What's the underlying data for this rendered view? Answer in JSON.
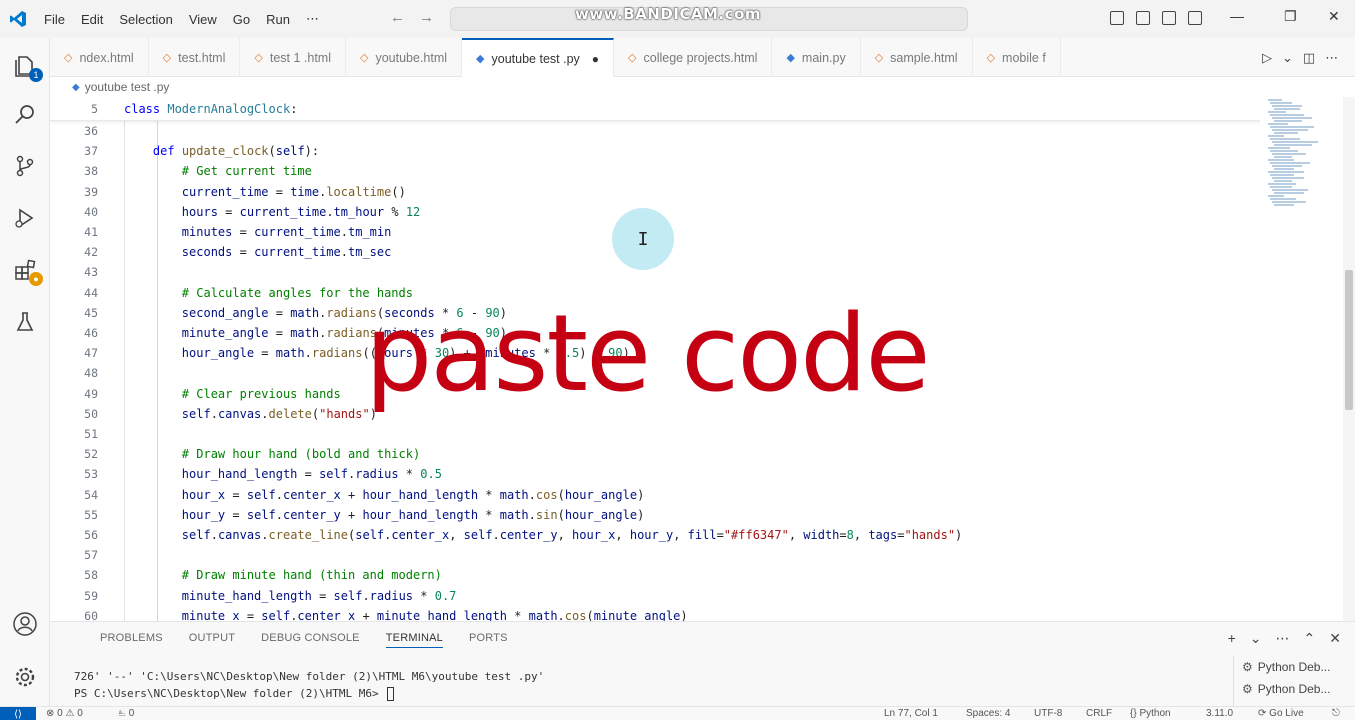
{
  "menu": [
    "File",
    "Edit",
    "Selection",
    "View",
    "Go",
    "Run",
    "⋯"
  ],
  "watermark": "www.BANDICAM.com",
  "tabs": [
    {
      "label": "ndex.html",
      "icon": "html-icon",
      "active": false
    },
    {
      "label": "test.html",
      "icon": "html-icon",
      "active": false
    },
    {
      "label": "test 1 .html",
      "icon": "html-icon",
      "active": false
    },
    {
      "label": "youtube.html",
      "icon": "html-icon",
      "active": false
    },
    {
      "label": "youtube test .py",
      "icon": "python-icon",
      "active": true,
      "modified": true
    },
    {
      "label": "college projects.html",
      "icon": "html-icon",
      "active": false
    },
    {
      "label": "main.py",
      "icon": "python-icon",
      "active": false
    },
    {
      "label": "sample.html",
      "icon": "html-icon",
      "active": false
    },
    {
      "label": "mobile f",
      "icon": "html-icon",
      "active": false
    }
  ],
  "breadcrumb": "youtube test .py",
  "sticky": {
    "ln": "5",
    "kw": "class",
    "name": "ModernAnalogClock",
    "tail": ":"
  },
  "code": [
    {
      "ln": "36",
      "t": []
    },
    {
      "ln": "37",
      "t": [
        [
          "    ",
          ""
        ],
        [
          "def",
          "kw"
        ],
        [
          " ",
          ""
        ],
        [
          "update_clock",
          "fn"
        ],
        [
          "(",
          ""
        ],
        [
          "self",
          "var"
        ],
        [
          "):",
          ""
        ]
      ]
    },
    {
      "ln": "38",
      "t": [
        [
          "        ",
          ""
        ],
        [
          "# Get current time",
          "cm"
        ]
      ]
    },
    {
      "ln": "39",
      "t": [
        [
          "        ",
          ""
        ],
        [
          "current_time",
          "var"
        ],
        [
          " = ",
          ""
        ],
        [
          "time",
          "var"
        ],
        [
          ".",
          ""
        ],
        [
          "localtime",
          "fn"
        ],
        [
          "()",
          ""
        ]
      ]
    },
    {
      "ln": "40",
      "t": [
        [
          "        ",
          ""
        ],
        [
          "hours",
          "var"
        ],
        [
          " = ",
          ""
        ],
        [
          "current_time",
          "var"
        ],
        [
          ".",
          ""
        ],
        [
          "tm_hour",
          "var"
        ],
        [
          " % ",
          ""
        ],
        [
          "12",
          "num"
        ]
      ]
    },
    {
      "ln": "41",
      "t": [
        [
          "        ",
          ""
        ],
        [
          "minutes",
          "var"
        ],
        [
          " = ",
          ""
        ],
        [
          "current_time",
          "var"
        ],
        [
          ".",
          ""
        ],
        [
          "tm_min",
          "var"
        ]
      ]
    },
    {
      "ln": "42",
      "t": [
        [
          "        ",
          ""
        ],
        [
          "seconds",
          "var"
        ],
        [
          " = ",
          ""
        ],
        [
          "current_time",
          "var"
        ],
        [
          ".",
          ""
        ],
        [
          "tm_sec",
          "var"
        ]
      ]
    },
    {
      "ln": "43",
      "t": []
    },
    {
      "ln": "44",
      "t": [
        [
          "        ",
          ""
        ],
        [
          "# Calculate angles for the hands",
          "cm"
        ]
      ]
    },
    {
      "ln": "45",
      "t": [
        [
          "        ",
          ""
        ],
        [
          "second_angle",
          "var"
        ],
        [
          " = ",
          ""
        ],
        [
          "math",
          "var"
        ],
        [
          ".",
          ""
        ],
        [
          "radians",
          "fn"
        ],
        [
          "(",
          ""
        ],
        [
          "seconds",
          "var"
        ],
        [
          " * ",
          ""
        ],
        [
          "6",
          "num"
        ],
        [
          " - ",
          ""
        ],
        [
          "90",
          "num"
        ],
        [
          ")",
          ""
        ]
      ]
    },
    {
      "ln": "46",
      "t": [
        [
          "        ",
          ""
        ],
        [
          "minute_angle",
          "var"
        ],
        [
          " = ",
          ""
        ],
        [
          "math",
          "var"
        ],
        [
          ".",
          ""
        ],
        [
          "radians",
          "fn"
        ],
        [
          "(",
          ""
        ],
        [
          "minutes",
          "var"
        ],
        [
          " * ",
          ""
        ],
        [
          "6",
          "num"
        ],
        [
          " - ",
          ""
        ],
        [
          "90",
          "num"
        ],
        [
          ")",
          ""
        ]
      ]
    },
    {
      "ln": "47",
      "t": [
        [
          "        ",
          ""
        ],
        [
          "hour_angle",
          "var"
        ],
        [
          " = ",
          ""
        ],
        [
          "math",
          "var"
        ],
        [
          ".",
          ""
        ],
        [
          "radians",
          "fn"
        ],
        [
          "((",
          ""
        ],
        [
          "hours",
          "var"
        ],
        [
          " * ",
          ""
        ],
        [
          "30",
          "num"
        ],
        [
          ") + (",
          ""
        ],
        [
          "minutes",
          "var"
        ],
        [
          " * ",
          ""
        ],
        [
          "0.5",
          "num"
        ],
        [
          ") - ",
          ""
        ],
        [
          "90",
          "num"
        ],
        [
          ")",
          ""
        ]
      ]
    },
    {
      "ln": "48",
      "t": []
    },
    {
      "ln": "49",
      "t": [
        [
          "        ",
          ""
        ],
        [
          "# Clear previous hands",
          "cm"
        ]
      ]
    },
    {
      "ln": "50",
      "t": [
        [
          "        ",
          ""
        ],
        [
          "self",
          "var"
        ],
        [
          ".",
          ""
        ],
        [
          "canvas",
          "var"
        ],
        [
          ".",
          ""
        ],
        [
          "delete",
          "fn"
        ],
        [
          "(",
          ""
        ],
        [
          "\"hands\"",
          "str"
        ],
        [
          ")",
          ""
        ]
      ]
    },
    {
      "ln": "51",
      "t": []
    },
    {
      "ln": "52",
      "t": [
        [
          "        ",
          ""
        ],
        [
          "# Draw hour hand (bold and thick)",
          "cm"
        ]
      ]
    },
    {
      "ln": "53",
      "t": [
        [
          "        ",
          ""
        ],
        [
          "hour_hand_length",
          "var"
        ],
        [
          " = ",
          ""
        ],
        [
          "self",
          "var"
        ],
        [
          ".",
          ""
        ],
        [
          "radius",
          "var"
        ],
        [
          " * ",
          ""
        ],
        [
          "0.5",
          "num"
        ]
      ]
    },
    {
      "ln": "54",
      "t": [
        [
          "        ",
          ""
        ],
        [
          "hour_x",
          "var"
        ],
        [
          " = ",
          ""
        ],
        [
          "self",
          "var"
        ],
        [
          ".",
          ""
        ],
        [
          "center_x",
          "var"
        ],
        [
          " + ",
          ""
        ],
        [
          "hour_hand_length",
          "var"
        ],
        [
          " * ",
          ""
        ],
        [
          "math",
          "var"
        ],
        [
          ".",
          ""
        ],
        [
          "cos",
          "fn"
        ],
        [
          "(",
          ""
        ],
        [
          "hour_angle",
          "var"
        ],
        [
          ")",
          ""
        ]
      ]
    },
    {
      "ln": "55",
      "t": [
        [
          "        ",
          ""
        ],
        [
          "hour_y",
          "var"
        ],
        [
          " = ",
          ""
        ],
        [
          "self",
          "var"
        ],
        [
          ".",
          ""
        ],
        [
          "center_y",
          "var"
        ],
        [
          " + ",
          ""
        ],
        [
          "hour_hand_length",
          "var"
        ],
        [
          " * ",
          ""
        ],
        [
          "math",
          "var"
        ],
        [
          ".",
          ""
        ],
        [
          "sin",
          "fn"
        ],
        [
          "(",
          ""
        ],
        [
          "hour_angle",
          "var"
        ],
        [
          ")",
          ""
        ]
      ]
    },
    {
      "ln": "56",
      "t": [
        [
          "        ",
          ""
        ],
        [
          "self",
          "var"
        ],
        [
          ".",
          ""
        ],
        [
          "canvas",
          "var"
        ],
        [
          ".",
          ""
        ],
        [
          "create_line",
          "fn"
        ],
        [
          "(",
          ""
        ],
        [
          "self",
          "var"
        ],
        [
          ".",
          ""
        ],
        [
          "center_x",
          "var"
        ],
        [
          ", ",
          ""
        ],
        [
          "self",
          "var"
        ],
        [
          ".",
          ""
        ],
        [
          "center_y",
          "var"
        ],
        [
          ", ",
          ""
        ],
        [
          "hour_x",
          "var"
        ],
        [
          ", ",
          ""
        ],
        [
          "hour_y",
          "var"
        ],
        [
          ", ",
          ""
        ],
        [
          "fill",
          "var"
        ],
        [
          "=",
          ""
        ],
        [
          "\"#ff6347\"",
          "str"
        ],
        [
          ", ",
          ""
        ],
        [
          "width",
          "var"
        ],
        [
          "=",
          ""
        ],
        [
          "8",
          "num"
        ],
        [
          ", ",
          ""
        ],
        [
          "tags",
          "var"
        ],
        [
          "=",
          ""
        ],
        [
          "\"hands\"",
          "str"
        ],
        [
          ")",
          ""
        ]
      ]
    },
    {
      "ln": "57",
      "t": []
    },
    {
      "ln": "58",
      "t": [
        [
          "        ",
          ""
        ],
        [
          "# Draw minute hand (thin and modern)",
          "cm"
        ]
      ]
    },
    {
      "ln": "59",
      "t": [
        [
          "        ",
          ""
        ],
        [
          "minute_hand_length",
          "var"
        ],
        [
          " = ",
          ""
        ],
        [
          "self",
          "var"
        ],
        [
          ".",
          ""
        ],
        [
          "radius",
          "var"
        ],
        [
          " * ",
          ""
        ],
        [
          "0.7",
          "num"
        ]
      ]
    },
    {
      "ln": "60",
      "t": [
        [
          "        ",
          ""
        ],
        [
          "minute_x",
          "var"
        ],
        [
          " = ",
          ""
        ],
        [
          "self",
          "var"
        ],
        [
          ".",
          ""
        ],
        [
          "center_x",
          "var"
        ],
        [
          " + ",
          ""
        ],
        [
          "minute_hand_length",
          "var"
        ],
        [
          " * ",
          ""
        ],
        [
          "math",
          "var"
        ],
        [
          ".",
          ""
        ],
        [
          "cos",
          "fn"
        ],
        [
          "(",
          ""
        ],
        [
          "minute_angle",
          "var"
        ],
        [
          ")",
          ""
        ]
      ]
    }
  ],
  "overlay_text": "paste code",
  "panel": {
    "tabs": [
      "PROBLEMS",
      "OUTPUT",
      "DEBUG CONSOLE",
      "TERMINAL",
      "PORTS"
    ],
    "active_tab": "TERMINAL",
    "terminal_line1": "726' '--' 'C:\\Users\\NC\\Desktop\\New folder (2)\\HTML M6\\youtube test .py'",
    "terminal_line2": "PS C:\\Users\\NC\\Desktop\\New folder (2)\\HTML M6> ",
    "terminals": [
      "Python Deb...",
      "Python Deb..."
    ]
  },
  "status": {
    "errors": "0",
    "warnings": "0",
    "ports": "0",
    "position": "Ln 77, Col 1",
    "spaces": "Spaces: 4",
    "encoding": "UTF-8",
    "eol": "CRLF",
    "language": "Python",
    "version": "3.11.0",
    "golive": "Go Live"
  },
  "colors": {
    "accent": "#005fb8",
    "overlay": "#c40012",
    "keyword": "#0000ff",
    "comment": "#008000"
  }
}
